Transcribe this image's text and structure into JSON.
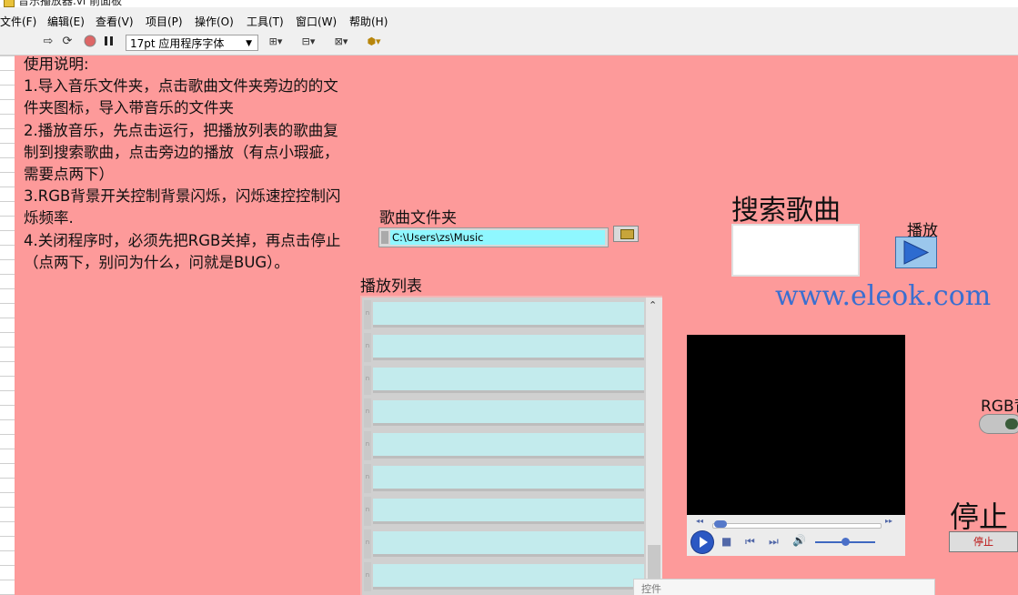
{
  "window": {
    "title": "音乐播放器.vi 前面板"
  },
  "menu": {
    "items": [
      "文件(F)",
      "编辑(E)",
      "查看(V)",
      "项目(P)",
      "操作(O)",
      "工具(T)",
      "窗口(W)",
      "帮助(H)"
    ]
  },
  "toolbar": {
    "font_selector": "17pt 应用程序字体",
    "run_icon": "run-arrow-icon",
    "continuous_run_icon": "continuous-run-icon",
    "abort_icon": "abort-icon",
    "pause_icon": "pause-icon"
  },
  "instructions": {
    "lines": [
      "使用说明:",
      "1.导入音乐文件夹，点击歌曲文件夹旁边的的文",
      "件夹图标，导入带音乐的文件夹",
      "2.播放音乐，先点击运行，把播放列表的歌曲复",
      "制到搜索歌曲，点击旁边的播放（有点小瑕疵，",
      "需要点两下）",
      "3.RGB背景开关控制背景闪烁，闪烁速控控制闪",
      "烁频率.",
      "4.关闭程序时，必须先把RGB关掉，再点击停止",
      "（点两下，别问为什么，问就是BUG）。"
    ]
  },
  "folder": {
    "label": "歌曲文件夹",
    "path": "C:\\Users\\zs\\Music"
  },
  "search": {
    "title": "搜索歌曲",
    "value": ""
  },
  "play": {
    "label": "播放"
  },
  "watermark": {
    "url": "www.eleok.com"
  },
  "playlist": {
    "label": "播放列表",
    "rows": [
      "",
      "",
      "",
      "",
      "",
      "",
      "",
      "",
      ""
    ]
  },
  "rgb": {
    "label": "RGB背"
  },
  "stop": {
    "title": "停止",
    "button_label": "停止"
  },
  "popup": {
    "text": "控件"
  },
  "colors": {
    "panel": "#fd9a9a",
    "path_bg": "#8ff7ff",
    "list_cell": "#c3ebed",
    "url": "#3a6fd0"
  }
}
